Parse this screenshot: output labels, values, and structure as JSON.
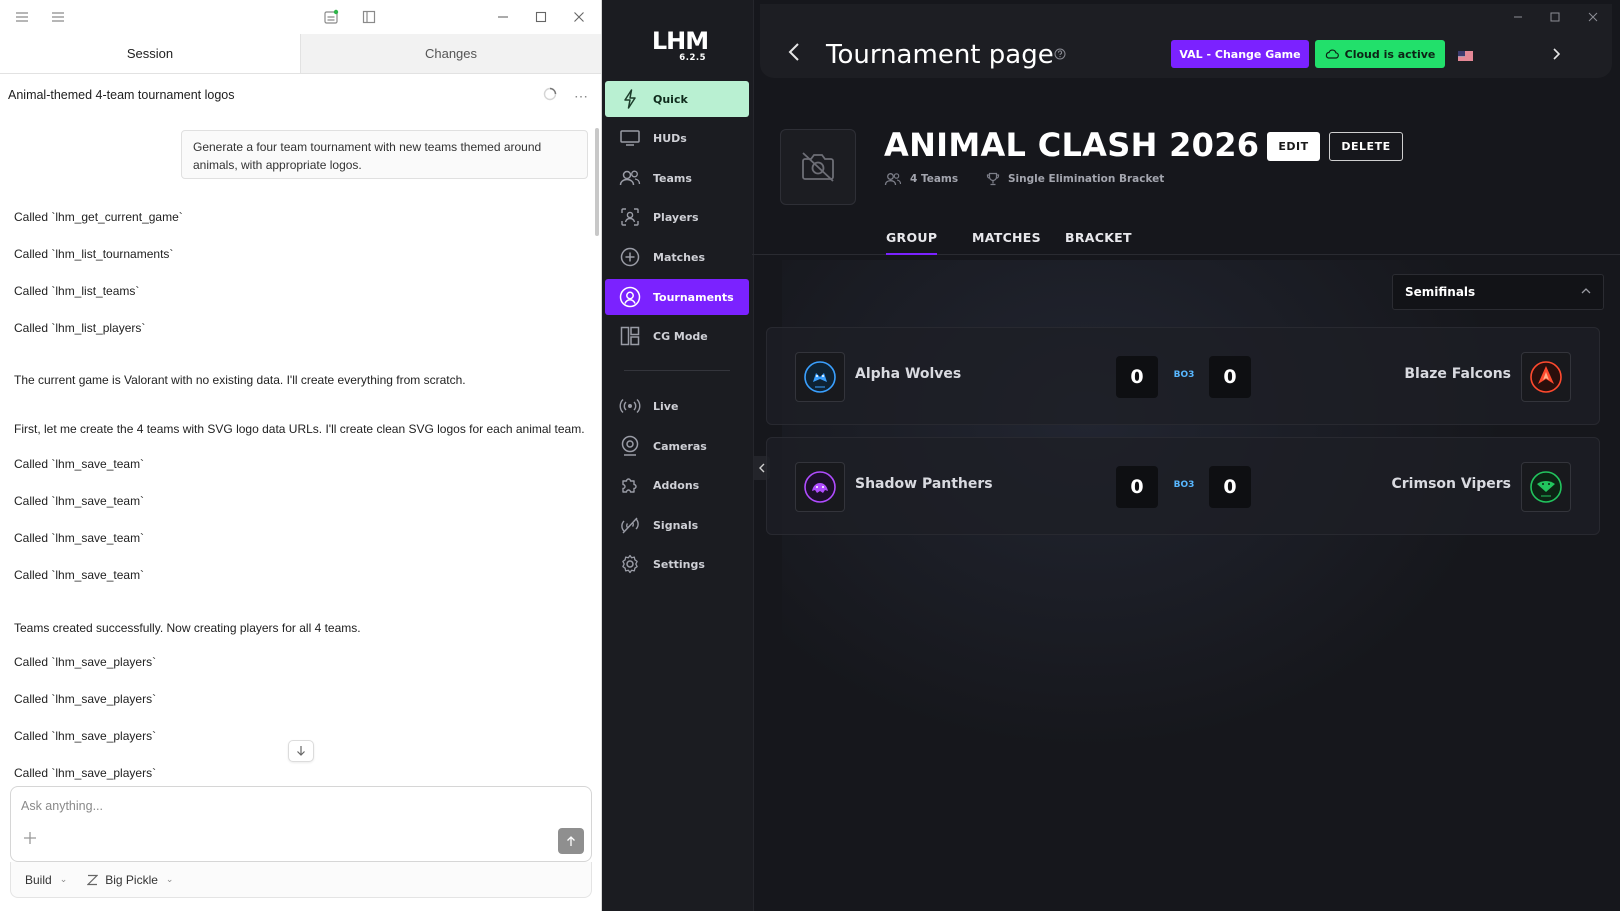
{
  "chat": {
    "tabs": [
      {
        "label": "Session"
      },
      {
        "label": "Changes"
      }
    ],
    "session_title": "Animal-themed 4-team tournament logos",
    "user_message": "Generate a four team tournament with new teams themed around animals, with appropriate logos.",
    "log": [
      "Called `lhm_get_current_game`",
      "Called `lhm_list_tournaments`",
      "Called `lhm_list_teams`",
      "Called `lhm_list_players`",
      "The current game is Valorant with no existing data. I'll create everything from scratch.",
      "First, let me create the 4 teams with SVG logo data URLs. I'll create clean SVG logos for each animal team.",
      "Called `lhm_save_team`",
      "Called `lhm_save_team`",
      "Called `lhm_save_team`",
      "Called `lhm_save_team`",
      "Teams created successfully. Now creating players for all 4 teams.",
      "Called `lhm_save_players`",
      "Called `lhm_save_players`",
      "Called `lhm_save_players`",
      "Called `lhm_save_players`"
    ],
    "composer_placeholder": "Ask anything...",
    "mode_label": "Build",
    "agent_label": "Big Pickle"
  },
  "app": {
    "logo_text": "LHM",
    "version": "6.2.5",
    "nav": [
      {
        "label": "Quick",
        "icon": "bolt-icon"
      },
      {
        "label": "HUDs",
        "icon": "monitor-icon"
      },
      {
        "label": "Teams",
        "icon": "users-icon"
      },
      {
        "label": "Players",
        "icon": "player-icon"
      },
      {
        "label": "Matches",
        "icon": "plus-circle-icon"
      },
      {
        "label": "Tournaments",
        "icon": "tournament-icon"
      },
      {
        "label": "CG Mode",
        "icon": "layout-icon"
      },
      {
        "label": "Live",
        "icon": "broadcast-icon"
      },
      {
        "label": "Cameras",
        "icon": "camera-icon"
      },
      {
        "label": "Addons",
        "icon": "puzzle-icon"
      },
      {
        "label": "Signals",
        "icon": "signal-icon"
      },
      {
        "label": "Settings",
        "icon": "gear-icon"
      }
    ],
    "active_nav": "Tournaments",
    "header": {
      "title": "Tournament page",
      "game_button": "VAL - Change Game",
      "cloud_button": "Cloud is active"
    },
    "tournament": {
      "name": "ANIMAL CLASH 2026",
      "edit_label": "EDIT",
      "delete_label": "DELETE",
      "teams_count": "4 Teams",
      "format": "Single Elimination Bracket"
    },
    "sub_tabs": [
      "GROUP",
      "MATCHES",
      "BRACKET"
    ],
    "active_sub_tab": "GROUP",
    "round_select": "Semifinals",
    "matches": [
      {
        "left_team": "Alpha Wolves",
        "left_score": "0",
        "format": "BO3",
        "right_score": "0",
        "right_team": "Blaze Falcons",
        "left_color": "#3aa0ff",
        "right_color": "#ff4a2e"
      },
      {
        "left_team": "Shadow Panthers",
        "left_score": "0",
        "format": "BO3",
        "right_score": "0",
        "right_team": "Crimson Vipers",
        "left_color": "#b04cff",
        "right_color": "#22c55e"
      }
    ],
    "colors": {
      "accent": "#7b22ff",
      "quick": "#b9f0d2",
      "cloud": "#22e06b",
      "bo_label": "#58b7ff"
    }
  }
}
